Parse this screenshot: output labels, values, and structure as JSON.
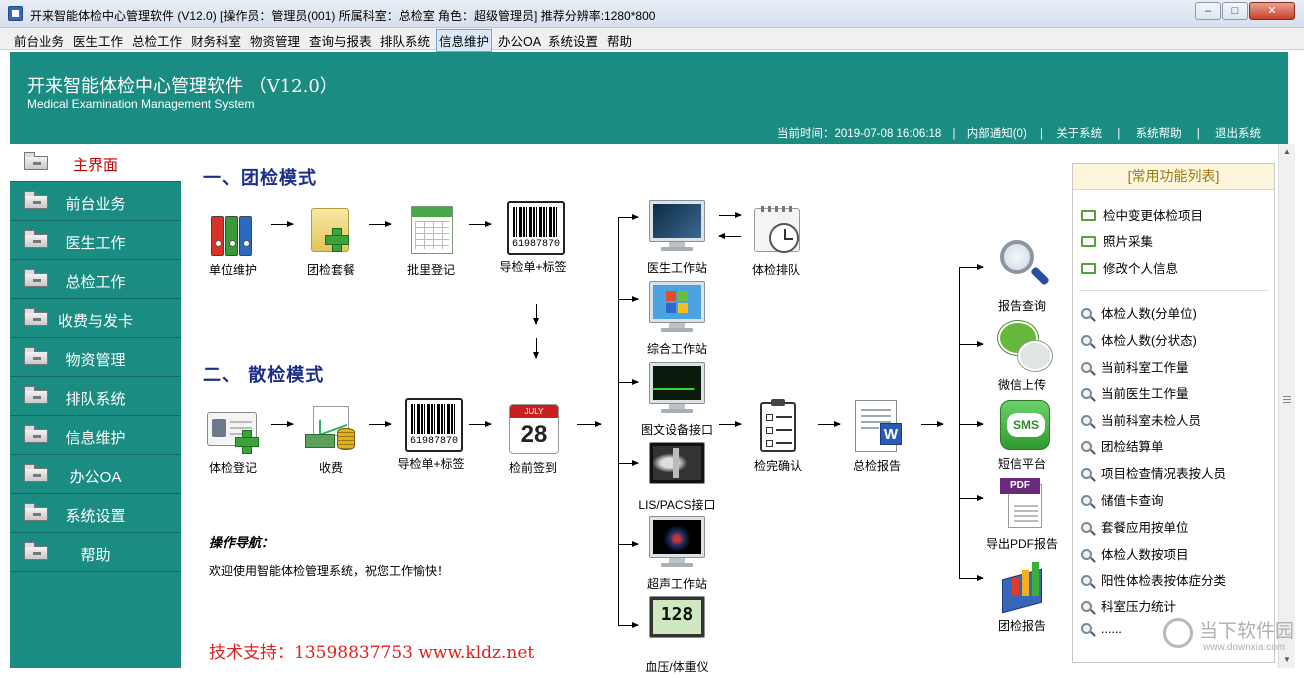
{
  "window": {
    "title": "开来智能体检中心管理软件 (V12.0)   [操作员：管理员(001)   所属科室：总检室   角色：超级管理员]  推荐分辨率:1280*800",
    "min": "–",
    "max": "□",
    "close": "✕"
  },
  "menu": [
    "前台业务",
    "医生工作",
    "总检工作",
    "财务科室",
    "物资管理",
    "查询与报表",
    "排队系统",
    "信息维护",
    "办公OA",
    "系统设置",
    "帮助"
  ],
  "header": {
    "title": "开来智能体检中心管理软件 （V12.0）",
    "subtitle": "Medical Examination Management System",
    "time_label": "当前时间：2019-07-08 16:06:18",
    "notice": "内部通知(0)",
    "about": "关于系统",
    "help": "系统帮助",
    "exit": "退出系统",
    "sep": "|"
  },
  "sidebar": [
    {
      "label": "主界面",
      "active": true
    },
    {
      "label": "前台业务"
    },
    {
      "label": "医生工作"
    },
    {
      "label": "总检工作"
    },
    {
      "label": "收费与发卡"
    },
    {
      "label": "物资管理"
    },
    {
      "label": "排队系统"
    },
    {
      "label": "信息维护"
    },
    {
      "label": "办公OA"
    },
    {
      "label": "系统设置"
    },
    {
      "label": "帮助"
    }
  ],
  "flow": {
    "group_title": "一、团检模式",
    "single_title": "二、 散检模式",
    "group_nodes": [
      "单位维护",
      "团检套餐",
      "批里登记",
      "导检单+标签"
    ],
    "single_nodes": [
      "体检登记",
      "收费",
      "导检单+标签",
      "检前签到"
    ],
    "stations": [
      "医生工作站",
      "综合工作站",
      "图文设备接口",
      "LIS/PACS接口",
      "超声工作站",
      "血压/体重仪"
    ],
    "queue": "体检排队",
    "confirm": "检完确认",
    "final_report": "总检报告",
    "outputs": [
      "报告查询",
      "微信上传",
      "短信平台",
      "导出PDF报告",
      "团检报告"
    ],
    "barcode_number": "61987870",
    "cal_month": "JULY",
    "cal_day": "28",
    "sms": "SMS",
    "pdf": "PDF",
    "word": "W",
    "bp_display": "128"
  },
  "nav": {
    "title": "操作导航：",
    "text": "欢迎使用智能体检管理系统，祝您工作愉快！"
  },
  "support": "技术支持：13598837753  www.kldz.net",
  "quick": {
    "title": "[常用功能列表]",
    "top": [
      "检中变更体检项目",
      "照片采集",
      "修改个人信息"
    ],
    "stats": [
      "体检人数(分单位)",
      "体检人数(分状态)",
      "当前科室工作量",
      "当前医生工作量",
      "当前科室未检人员",
      "团检结算单",
      "项目检查情况表按人员",
      "储值卡查询",
      "套餐应用按单位",
      "体检人数按项目",
      "阳性体检表按体症分类",
      "科室压力统计",
      "......"
    ]
  },
  "watermark": {
    "cn": "当下软件园",
    "en": "www.downxia.com"
  },
  "colors": {
    "teal": "#1a8c82",
    "active_red": "#c40000",
    "section_blue": "#1b2e8a",
    "support_red": "#e02020"
  }
}
